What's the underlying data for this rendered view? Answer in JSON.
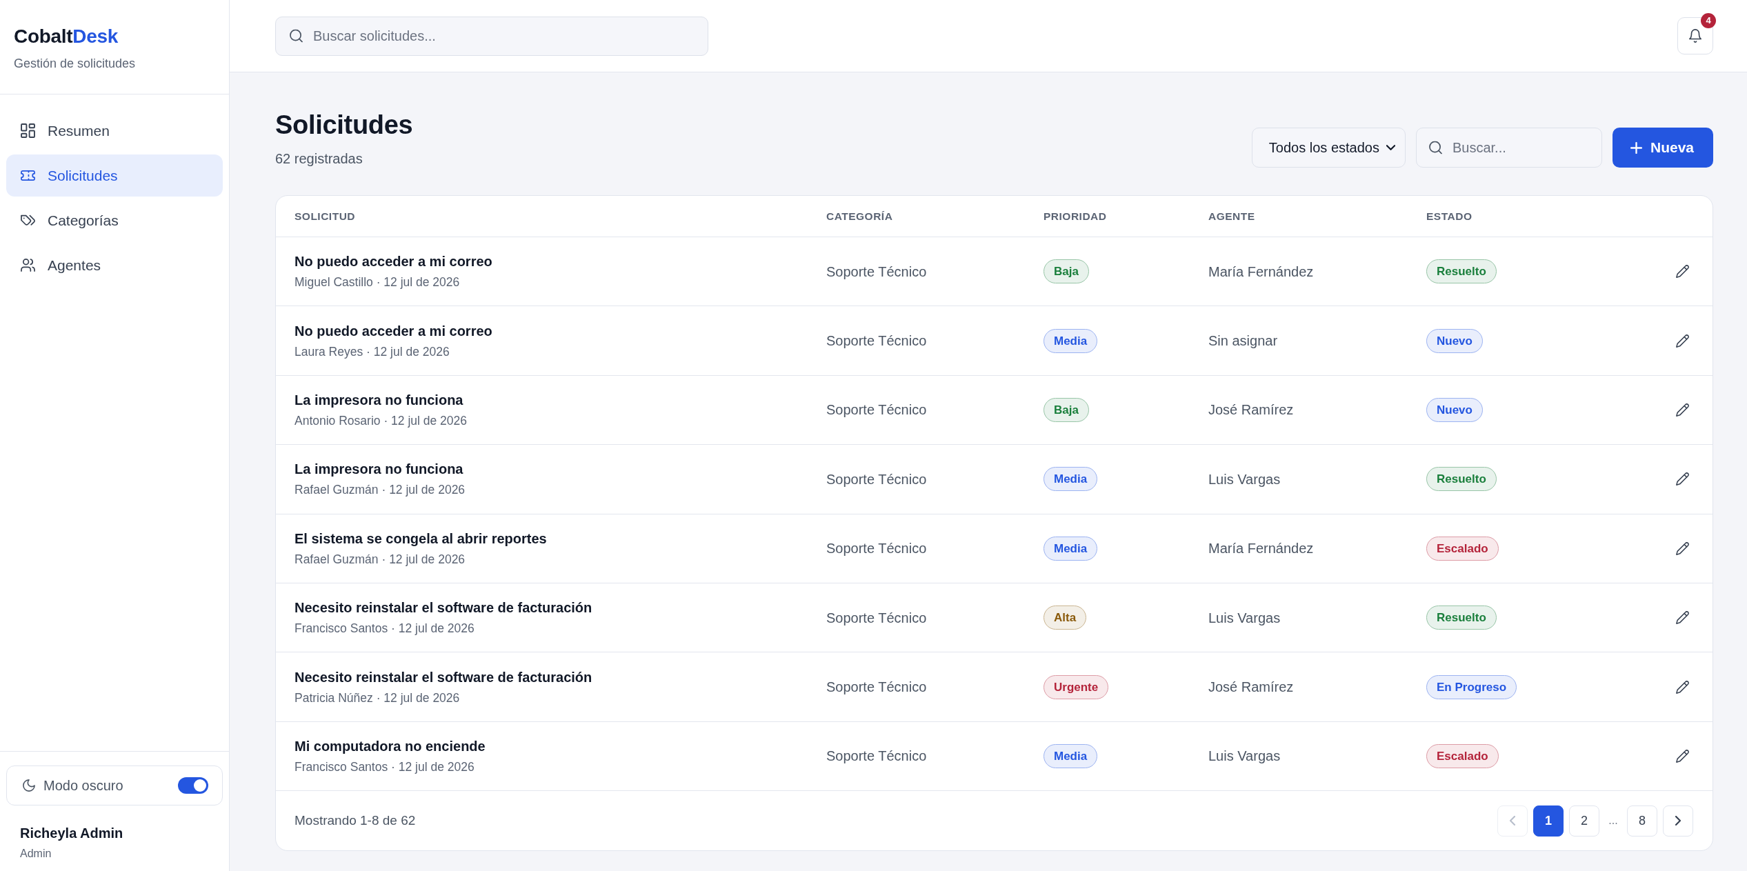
{
  "sidebar": {
    "brand": {
      "text": "Cobalt",
      "accent": "Desk"
    },
    "subtitle": "Gestión de solicitudes",
    "items": [
      {
        "label": "Resumen",
        "selected": false
      },
      {
        "label": "Solicitudes",
        "selected": true
      },
      {
        "label": "Categorías",
        "selected": false
      },
      {
        "label": "Agentes",
        "selected": false
      }
    ],
    "dark_mode": {
      "label": "Modo oscuro",
      "on": true
    },
    "user": {
      "name": "Richeyla Admin",
      "role": "Admin"
    }
  },
  "topbar": {
    "search": {
      "placeholder": "Buscar solicitudes..."
    },
    "notifications": {
      "count": "4"
    }
  },
  "page_header": {
    "title": "Solicitudes",
    "subtitle": "62 registradas",
    "status_filter": {
      "value": "Todos los estados"
    },
    "search": {
      "placeholder": "Buscar..."
    },
    "new_button": {
      "label": "Nueva"
    }
  },
  "table": {
    "columns": [
      "SOLICITUD",
      "CATEGORÍA",
      "PRIORIDAD",
      "AGENTE",
      "ESTADO"
    ],
    "rows": [
      {
        "title": "No puedo acceder a mi correo",
        "meta": "Miguel Castillo · 12 jul de 2026",
        "category": "Soporte Técnico",
        "priority": {
          "label": "Baja",
          "color": "#1a7f3c"
        },
        "agent": "María Fernández",
        "status": {
          "label": "Resuelto",
          "color": "#1a7f3c"
        }
      },
      {
        "title": "No puedo acceder a mi correo",
        "meta": "Laura Reyes · 12 jul de 2026",
        "category": "Soporte Técnico",
        "priority": {
          "label": "Media",
          "color": "#2456e0"
        },
        "agent": "Sin asignar",
        "status": {
          "label": "Nuevo",
          "color": "#2456e0"
        }
      },
      {
        "title": "La impresora no funciona",
        "meta": "Antonio Rosario · 12 jul de 2026",
        "category": "Soporte Técnico",
        "priority": {
          "label": "Baja",
          "color": "#1a7f3c"
        },
        "agent": "José Ramírez",
        "status": {
          "label": "Nuevo",
          "color": "#2456e0"
        }
      },
      {
        "title": "La impresora no funciona",
        "meta": "Rafael Guzmán · 12 jul de 2026",
        "category": "Soporte Técnico",
        "priority": {
          "label": "Media",
          "color": "#2456e0"
        },
        "agent": "Luis Vargas",
        "status": {
          "label": "Resuelto",
          "color": "#1a7f3c"
        }
      },
      {
        "title": "El sistema se congela al abrir reportes",
        "meta": "Rafael Guzmán · 12 jul de 2026",
        "category": "Soporte Técnico",
        "priority": {
          "label": "Media",
          "color": "#2456e0"
        },
        "agent": "María Fernández",
        "status": {
          "label": "Escalado",
          "color": "#b4233a"
        }
      },
      {
        "title": "Necesito reinstalar el software de facturación",
        "meta": "Francisco Santos · 12 jul de 2026",
        "category": "Soporte Técnico",
        "priority": {
          "label": "Alta",
          "color": "#8a5a0b"
        },
        "agent": "Luis Vargas",
        "status": {
          "label": "Resuelto",
          "color": "#1a7f3c"
        }
      },
      {
        "title": "Necesito reinstalar el software de facturación",
        "meta": "Patricia Núñez · 12 jul de 2026",
        "category": "Soporte Técnico",
        "priority": {
          "label": "Urgente",
          "color": "#b4233a"
        },
        "agent": "José Ramírez",
        "status": {
          "label": "En Progreso",
          "color": "#2456e0"
        }
      },
      {
        "title": "Mi computadora no enciende",
        "meta": "Francisco Santos · 12 jul de 2026",
        "category": "Soporte Técnico",
        "priority": {
          "label": "Media",
          "color": "#2456e0"
        },
        "agent": "Luis Vargas",
        "status": {
          "label": "Escalado",
          "color": "#b4233a"
        }
      }
    ]
  },
  "pagination": {
    "summary": "Mostrando 1-8 de 62",
    "previous": {
      "disabled": true
    },
    "pages": [
      {
        "kind": "page",
        "label": "1",
        "selected": true
      },
      {
        "kind": "page",
        "label": "2",
        "selected": false
      },
      {
        "kind": "ellipsis",
        "label": "...",
        "selected": false
      },
      {
        "kind": "page",
        "label": "8",
        "selected": false
      }
    ],
    "next": {
      "disabled": false
    }
  }
}
